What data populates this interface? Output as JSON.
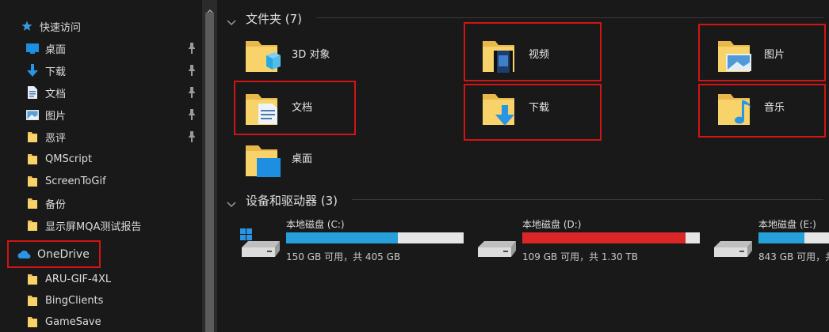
{
  "sidebar": {
    "quick_access": {
      "label": "快速访问",
      "icon": "star-icon"
    },
    "items": [
      {
        "label": "桌面",
        "icon": "desktop-icon",
        "pinned": true
      },
      {
        "label": "下载",
        "icon": "download-icon",
        "pinned": true
      },
      {
        "label": "文档",
        "icon": "document-icon",
        "pinned": true
      },
      {
        "label": "图片",
        "icon": "picture-icon",
        "pinned": true
      },
      {
        "label": "恶评",
        "icon": "folder-icon",
        "pinned": true
      },
      {
        "label": "QMScript",
        "icon": "folder-icon",
        "pinned": false
      },
      {
        "label": "ScreenToGif",
        "icon": "folder-icon",
        "pinned": false
      },
      {
        "label": "备份",
        "icon": "folder-icon",
        "pinned": false
      },
      {
        "label": "显示屏MQA测试报告",
        "icon": "folder-icon",
        "pinned": false
      }
    ],
    "onedrive": {
      "label": "OneDrive",
      "icon": "cloud-icon"
    },
    "onedrive_items": [
      {
        "label": "ARU-GIF-4XL",
        "icon": "folder-icon"
      },
      {
        "label": "BingClients",
        "icon": "folder-icon"
      },
      {
        "label": "GameSave",
        "icon": "folder-icon"
      }
    ]
  },
  "main": {
    "folders_header": "文件夹 (7)",
    "folders": [
      {
        "label": "3D 对象",
        "icon": "3d-objects-folder-icon"
      },
      {
        "label": "视频",
        "icon": "videos-folder-icon"
      },
      {
        "label": "图片",
        "icon": "pictures-folder-icon"
      },
      {
        "label": "文档",
        "icon": "documents-folder-icon"
      },
      {
        "label": "下载",
        "icon": "downloads-folder-icon"
      },
      {
        "label": "音乐",
        "icon": "music-folder-icon"
      },
      {
        "label": "桌面",
        "icon": "desktop-folder-icon"
      }
    ],
    "drives_header": "设备和驱动器 (3)",
    "drives": [
      {
        "name": "本地磁盘 (C:)",
        "free_text": "150 GB 可用，共 405 GB",
        "used_fraction": 0.63,
        "bar_color": "#26a0da",
        "icon": "windows-drive-icon"
      },
      {
        "name": "本地磁盘 (D:)",
        "free_text": "109 GB 可用，共 1.30 TB",
        "used_fraction": 0.92,
        "bar_color": "#da2626",
        "icon": "drive-icon"
      },
      {
        "name": "本地磁盘 (E:)",
        "free_text": "843 GB 可用，共",
        "used_fraction": 0.26,
        "bar_color": "#26a0da",
        "icon": "drive-icon"
      }
    ]
  },
  "colors": {
    "highlight_box": "#d21414",
    "accent_blue": "#26a0da",
    "warning_red": "#da2626",
    "folder_yellow": "#f8d36a"
  }
}
